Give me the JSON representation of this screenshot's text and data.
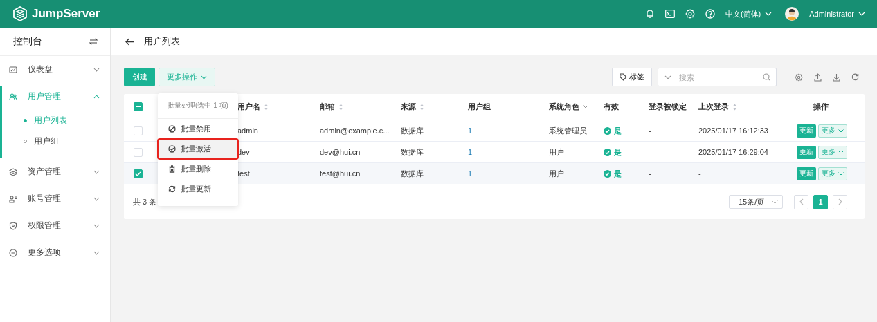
{
  "topbar": {
    "logo": "JumpServer",
    "language": "中文(简体)",
    "user": "Administrator"
  },
  "sidebar": {
    "title": "控制台",
    "items": [
      {
        "label": "仪表盘",
        "expanded": false,
        "selected": false
      },
      {
        "label": "用户管理",
        "expanded": true,
        "selected": true,
        "children": [
          {
            "label": "用户列表",
            "selected": true
          },
          {
            "label": "用户组",
            "selected": false
          }
        ]
      },
      {
        "label": "资产管理",
        "expanded": false,
        "selected": false
      },
      {
        "label": "账号管理",
        "expanded": false,
        "selected": false
      },
      {
        "label": "权限管理",
        "expanded": false,
        "selected": false
      },
      {
        "label": "更多选项",
        "expanded": false,
        "selected": false
      }
    ]
  },
  "page": {
    "title": "用户列表"
  },
  "toolbar": {
    "create": "创建",
    "more": "更多操作",
    "tag": "标签",
    "search_placeholder": "搜索"
  },
  "batch_menu": {
    "header": "批量处理(选中 1 项)",
    "items": [
      {
        "label": "批量禁用",
        "highlighted": false
      },
      {
        "label": "批量激活",
        "highlighted": true
      },
      {
        "label": "批量删除",
        "highlighted": false
      },
      {
        "label": "批量更新",
        "highlighted": false
      }
    ]
  },
  "table": {
    "indeterminate": true,
    "columns": [
      {
        "label": "用户名",
        "kind": "sort"
      },
      {
        "label": "邮箱",
        "kind": "sort"
      },
      {
        "label": "来源",
        "kind": "sort"
      },
      {
        "label": "用户组",
        "kind": "plain"
      },
      {
        "label": "系统角色",
        "kind": "filter"
      },
      {
        "label": "有效",
        "kind": "plain"
      },
      {
        "label": "登录被锁定",
        "kind": "plain"
      },
      {
        "label": "上次登录",
        "kind": "sort"
      },
      {
        "label": "操作",
        "kind": "plain"
      }
    ],
    "rows": [
      {
        "selected": false,
        "username": "admin",
        "email": "admin@example.c...",
        "source": "数据库",
        "groups": "1",
        "role": "系统管理员",
        "valid": "是",
        "locked": "-",
        "last_login": "2025/01/17 16:12:33",
        "update": "更新",
        "more": "更多"
      },
      {
        "selected": false,
        "username": "dev",
        "email": "dev@hui.cn",
        "source": "数据库",
        "groups": "1",
        "role": "用户",
        "valid": "是",
        "locked": "-",
        "last_login": "2025/01/17 16:29:04",
        "update": "更新",
        "more": "更多"
      },
      {
        "selected": true,
        "username": "test",
        "email": "test@hui.cn",
        "source": "数据库",
        "groups": "1",
        "role": "用户",
        "valid": "是",
        "locked": "-",
        "last_login": "-",
        "update": "更新",
        "more": "更多"
      }
    ],
    "total": "共 3 条",
    "page_size": "15条/页",
    "pages": [
      {
        "label": "1",
        "selected": true
      }
    ]
  }
}
